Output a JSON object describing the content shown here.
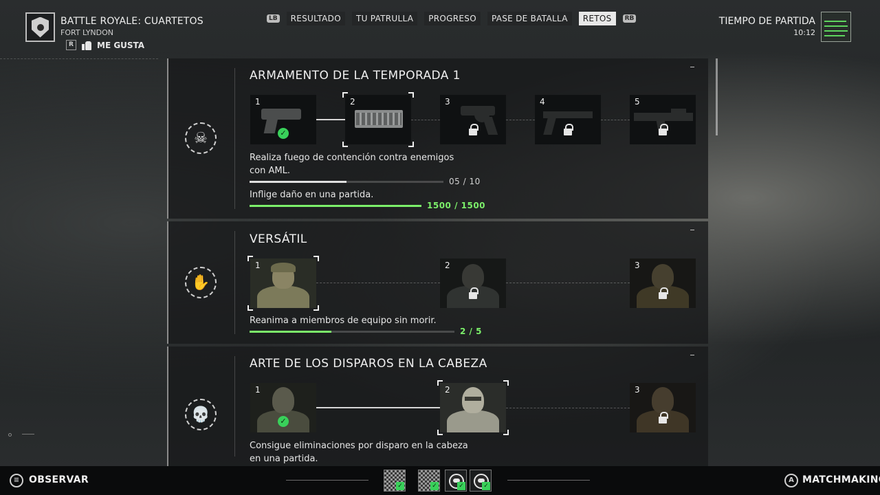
{
  "header": {
    "mode_title": "BATTLE ROYALE: CUARTETOS",
    "map_name": "FORT LYNDON",
    "rating_badge": "R",
    "like_label": "ME GUSTA",
    "bumper_left": "LB",
    "bumper_right": "RB",
    "tabs": [
      {
        "label": "RESULTADO",
        "active": false
      },
      {
        "label": "TU PATRULLA",
        "active": false
      },
      {
        "label": "PROGRESO",
        "active": false
      },
      {
        "label": "PASE DE BATALLA",
        "active": false
      },
      {
        "label": "RETOS",
        "active": true
      }
    ],
    "match_time_label": "TIEMPO DE PARTIDA",
    "match_time": "10:12"
  },
  "challenges": [
    {
      "title": "ARMAMENTO DE LA TEMPORADA 1",
      "icon": "skull-crossed-rifles-icon",
      "tiers": [
        {
          "num": "1",
          "state": "completed"
        },
        {
          "num": "2",
          "state": "current"
        },
        {
          "num": "3",
          "state": "locked"
        },
        {
          "num": "4",
          "state": "locked"
        },
        {
          "num": "5",
          "state": "locked"
        }
      ],
      "tasks": [
        {
          "desc_line1": "Realiza fuego de contención contra enemigos",
          "desc_line2": "con AML.",
          "progress_text": "05 / 10",
          "progress": 0.5,
          "completed": false
        },
        {
          "desc_line1": "Inflige daño en una partida.",
          "progress_text": "1500 / 1500",
          "progress": 1.0,
          "completed": true
        }
      ]
    },
    {
      "title": "VERSÁTIL",
      "icon": "hand-emblem-icon",
      "tiers": [
        {
          "num": "1",
          "state": "current"
        },
        {
          "num": "2",
          "state": "locked"
        },
        {
          "num": "3",
          "state": "locked"
        }
      ],
      "tasks": [
        {
          "desc_line1": "Reanima a miembros de equipo sin morir.",
          "progress_text": "2 / 5",
          "progress": 0.4,
          "completed": false
        }
      ]
    },
    {
      "title": "ARTE DE LOS DISPAROS EN LA CABEZA",
      "icon": "skull-emblem-icon",
      "tiers": [
        {
          "num": "1",
          "state": "completed"
        },
        {
          "num": "2",
          "state": "current"
        },
        {
          "num": "3",
          "state": "locked"
        }
      ],
      "tasks": [
        {
          "desc_line1": "Consigue eliminaciones por disparo en la cabeza",
          "desc_line2": "en una partida."
        }
      ]
    }
  ],
  "footer": {
    "observe_glyph": "≡",
    "observe_label": "OBSERVAR",
    "matchmaking_glyph": "A",
    "matchmaking_label": "MATCHMAKING"
  },
  "colors": {
    "progress_complete": "#7cf06a",
    "progress_partial": "#e0e0e0",
    "check": "#39d05a"
  }
}
